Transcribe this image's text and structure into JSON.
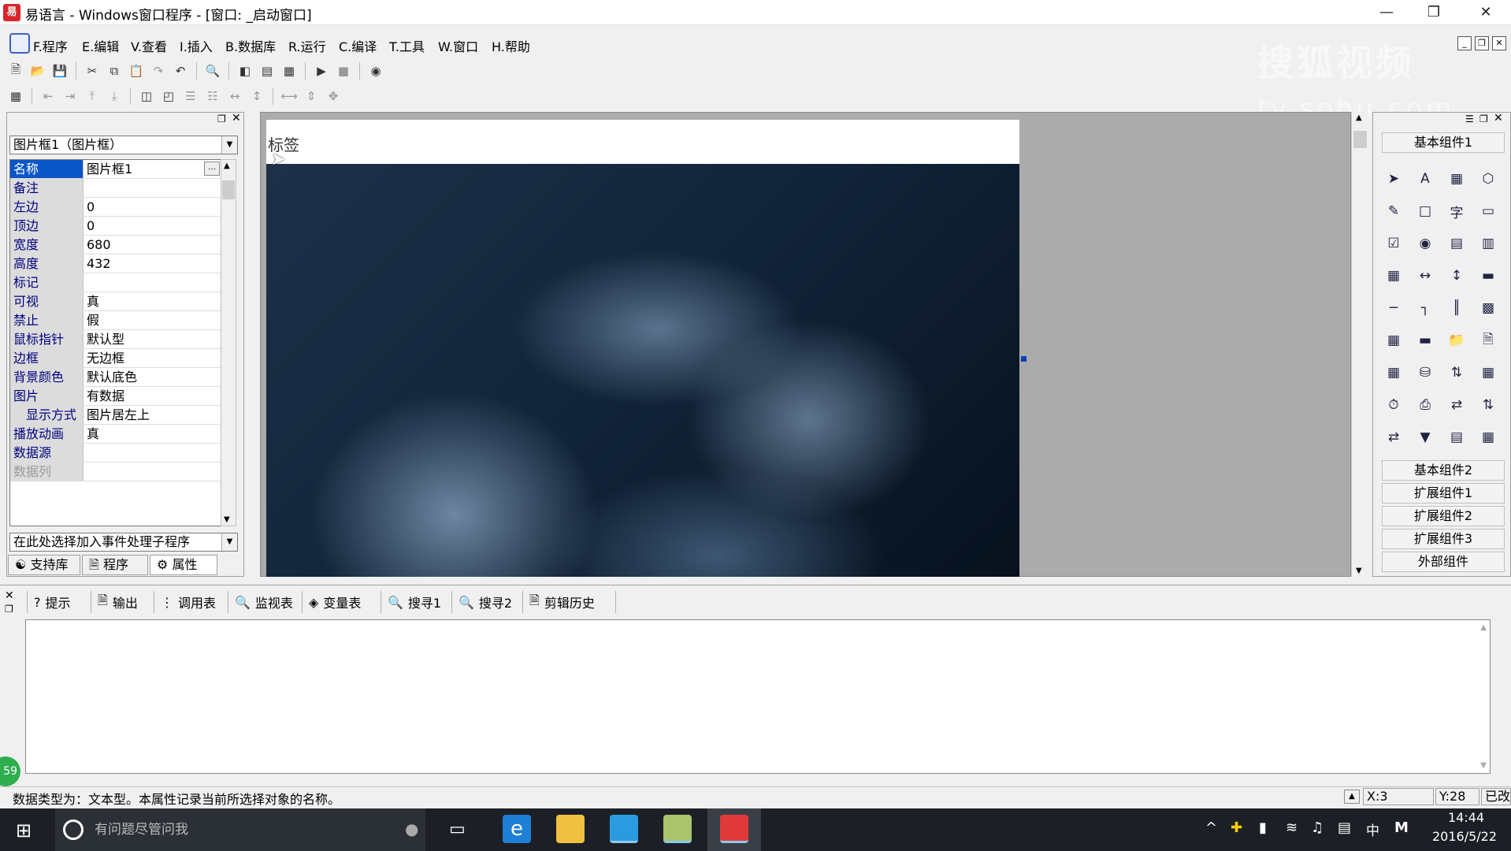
{
  "window": {
    "title": "易语言 - Windows窗口程序 - [窗口: _启动窗口]",
    "app_icon": "易"
  },
  "menu": [
    "F.程序",
    "E.编辑",
    "V.查看",
    "I.插入",
    "B.数据库",
    "R.运行",
    "C.编译",
    "T.工具",
    "W.窗口",
    "H.帮助"
  ],
  "watermark": {
    "line1": "搜狐视频",
    "line2": "tv.sohu.com"
  },
  "left_panel": {
    "object_select": "图片框1（图片框）",
    "properties": [
      {
        "name": "名称",
        "value": "图片框1"
      },
      {
        "name": "备注",
        "value": ""
      },
      {
        "name": "左边",
        "value": "0"
      },
      {
        "name": "顶边",
        "value": "0"
      },
      {
        "name": "宽度",
        "value": "680"
      },
      {
        "name": "高度",
        "value": "432"
      },
      {
        "name": "标记",
        "value": ""
      },
      {
        "name": "可视",
        "value": "真"
      },
      {
        "name": "禁止",
        "value": "假"
      },
      {
        "name": "鼠标指针",
        "value": "默认型"
      },
      {
        "name": "边框",
        "value": "无边框"
      },
      {
        "name": "背景颜色",
        "value": "默认底色"
      },
      {
        "name": "图片",
        "value": "有数据"
      },
      {
        "name": "显示方式",
        "value": "图片居左上"
      },
      {
        "name": "播放动画",
        "value": "真"
      },
      {
        "name": "数据源",
        "value": ""
      },
      {
        "name": "数据列",
        "value": ""
      }
    ],
    "event_select": "在此处选择加入事件处理子程序",
    "tabs": [
      "支持库",
      "程序",
      "属性"
    ]
  },
  "design": {
    "form_label": "标签"
  },
  "toolbox": {
    "group_top": "基本组件1",
    "groups": [
      "基本组件2",
      "扩展组件1",
      "扩展组件2",
      "扩展组件3",
      "外部组件"
    ]
  },
  "bottom_tabs": [
    "提示",
    "输出",
    "调用表",
    "监视表",
    "变量表",
    "搜寻1",
    "搜寻2",
    "剪辑历史"
  ],
  "status": {
    "text": "数据类型为：文本型。本属性记录当前所选择对象的名称。",
    "x": "X:3",
    "y": "Y:28",
    "mode": "已改"
  },
  "badge": "59",
  "taskbar": {
    "search_placeholder": "有问题尽管问我",
    "ime": "中",
    "time": "14:44",
    "date": "2016/5/22"
  }
}
